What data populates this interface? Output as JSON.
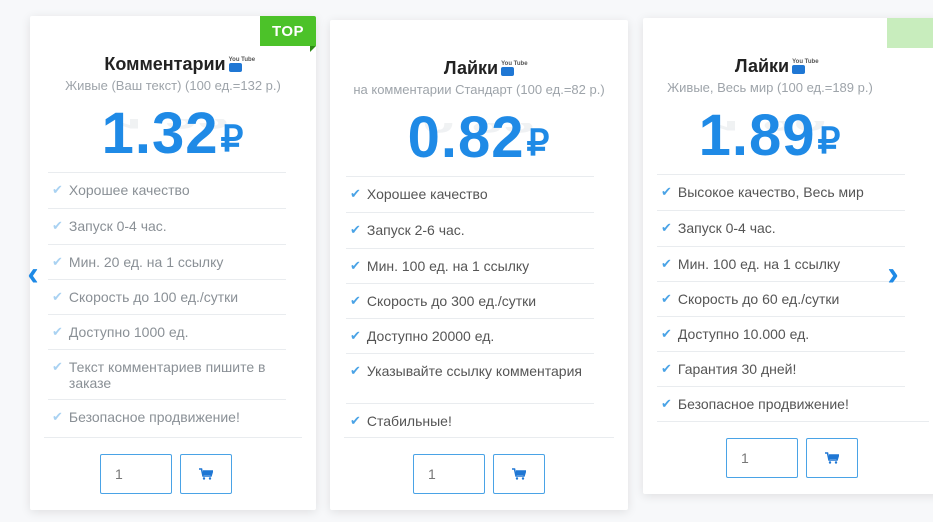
{
  "cards": [
    {
      "badge": "TOP",
      "title": "Комментарии",
      "subtitle": "Живые (Ваш текст) (100 ед.=132 р.)",
      "price": "1.32",
      "currency": "₽",
      "features": [
        "Хорошее качество",
        "Запуск 0-4 час.",
        "Мин. 20 ед. на 1 ссылку",
        "Скорость до 100 ед./сутки",
        "Доступно 1000 ед.",
        "Текст комментариев пишите в заказе",
        "Безопасное продвижение!"
      ],
      "quantity": "1"
    },
    {
      "title": "Лайки",
      "subtitle": "на комментарии Стандарт (100 ед.=82 р.)",
      "price": "0.82",
      "currency": "₽",
      "features": [
        "Хорошее качество",
        "Запуск 2-6 час.",
        "Мин. 100 ед. на 1 ссылку",
        "Скорость до 300 ед./сутки",
        "Доступно 20000 ед.",
        "Указывайте ссылку комментария",
        "Стабильные!"
      ],
      "quantity": "1"
    },
    {
      "title": "Лайки",
      "subtitle": "Живые, Весь мир (100 ед.=189 р.)",
      "price": "1.89",
      "currency": "₽",
      "features": [
        "Высокое качество, Весь мир",
        "Запуск 0-4 час.",
        "Мин. 100 ед. на 1 ссылку",
        "Скорость до 60 ед./сутки",
        "Доступно 10.000 ед.",
        "Гарантия 30 дней!",
        "Безопасное продвижение!"
      ],
      "quantity": "1"
    }
  ],
  "yt_icon_text": "You Tube",
  "nav": {
    "prev": "‹",
    "next": "›"
  },
  "icons": {
    "check": "check-icon",
    "cart": "cart-icon",
    "youtube": "youtube-icon"
  },
  "colors": {
    "accent": "#1f8ae6",
    "badge": "#4cc229",
    "check": "#4aa3e6"
  }
}
